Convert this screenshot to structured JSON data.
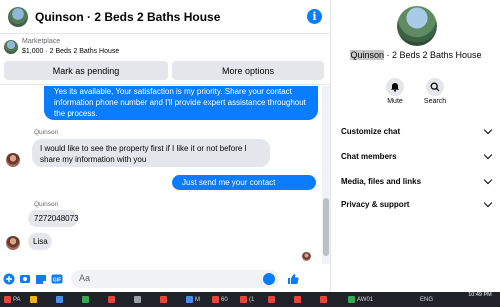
{
  "header": {
    "title": "Quinson · 2 Beds 2 Baths House",
    "info_icon": "info-icon",
    "info_glyph": "i",
    "accent": "#0a7cff"
  },
  "listing": {
    "category": "Marketplace",
    "price_title": "$1,000 · 2 Beds 2 Baths House",
    "mark_pending_label": "Mark as pending",
    "more_options_label": "More options"
  },
  "messages": [
    {
      "direction": "outgoing",
      "text": "Yes its available, Your satisfaction is my priority. Share your contact information phone number and I'll provide expert assistance throughout the process."
    },
    {
      "direction": "incoming",
      "sender": "Quinson",
      "text": "I would like to see the property first if I like it or not before I share my information with you"
    },
    {
      "direction": "outgoing",
      "text": "Just send me your contact number."
    },
    {
      "direction": "incoming",
      "sender": "Quinson",
      "text": "7272048073"
    },
    {
      "direction": "incoming",
      "text": "Lisa"
    }
  ],
  "composer": {
    "placeholder": "Aa",
    "icons": [
      "plus-icon",
      "camera-icon",
      "sticker-icon",
      "gif-icon",
      "emoji-icon",
      "like-icon"
    ],
    "gif_label": "GIF"
  },
  "panel": {
    "name_highlighted": "Quinson",
    "name_rest": " · 2 Beds 2 Baths House",
    "actions": [
      {
        "label": "Mute",
        "icon": "bell-icon"
      },
      {
        "label": "Search",
        "icon": "search-icon"
      }
    ],
    "sections": [
      {
        "label": "Customize chat"
      },
      {
        "label": "Chat members"
      },
      {
        "label": "Media, files and links"
      },
      {
        "label": "Privacy & support"
      }
    ]
  },
  "taskbar": {
    "items": [
      "PA",
      "",
      "",
      "",
      "M",
      "60",
      "(1",
      "",
      "",
      "AW01"
    ],
    "lang": "ENG",
    "time": "10:49 PM",
    "date": "",
    "colors": {
      "bg": "#1f2329"
    }
  }
}
